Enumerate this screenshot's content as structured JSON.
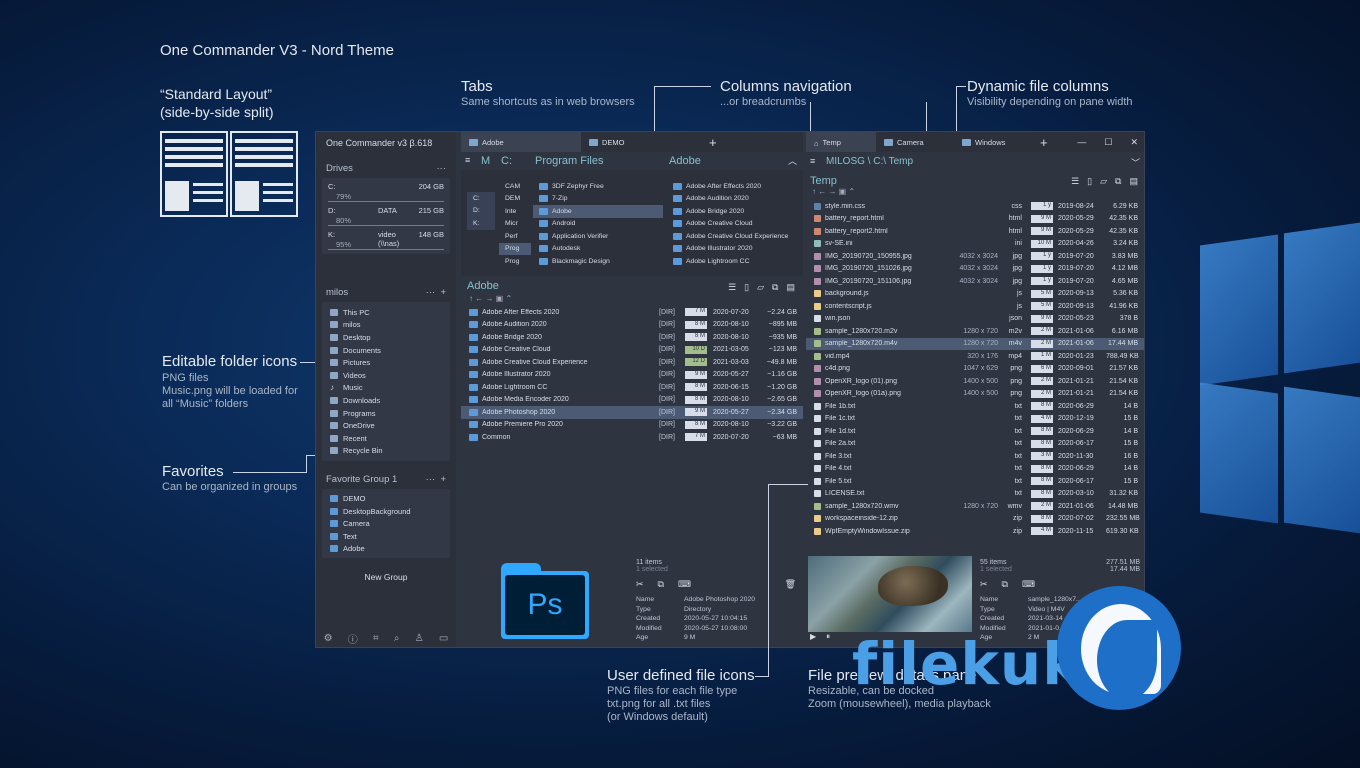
{
  "title": "One Commander V3 - Nord Theme",
  "annotations": {
    "layout": {
      "title": "“Standard Layout”",
      "subtitle": "(side-by-side split)"
    },
    "tabs": {
      "title": "Tabs",
      "subtitle": "Same shortcuts as in web browsers"
    },
    "columns_nav": {
      "title": "Columns navigation",
      "subtitle": "...or breadcrumbs"
    },
    "dynamic_cols": {
      "title": "Dynamic file columns",
      "subtitle": "Visibility depending on pane width"
    },
    "folder_icons": {
      "title": "Editable folder icons",
      "lines": [
        "PNG files",
        "Music.png will be loaded for",
        "all “Music” folders"
      ]
    },
    "favorites": {
      "title": "Favorites",
      "subtitle": "Can be organized in groups"
    },
    "file_icons": {
      "title": "User defined file icons",
      "lines": [
        "PNG files for each file type",
        "txt.png for all .txt files",
        "(or Windows default)"
      ]
    },
    "preview": {
      "title": "File preview, details pane",
      "lines": [
        "Resizable, can be docked",
        "Zoom (mousewheel), media playback"
      ]
    }
  },
  "app": {
    "title": "One Commander v3 β.618",
    "drives_header": "Drives",
    "drives": [
      {
        "name": "C:",
        "label": "",
        "percent": "79%",
        "size": "204 GB"
      },
      {
        "name": "D:",
        "label": "DATA",
        "percent": "80%",
        "size": "215 GB"
      },
      {
        "name": "K:",
        "label": "video (\\\\nas)",
        "percent": "95%",
        "size": "148 GB"
      }
    ],
    "user_header": "milos",
    "places": [
      "This PC",
      "milos",
      "Desktop",
      "Documents",
      "Pictures",
      "Videos",
      "Music",
      "Downloads",
      "Programs",
      "OneDrive",
      "Recent",
      "Recycle Bin"
    ],
    "fav_header": "Favorite Group 1",
    "favorites": [
      "DEMO",
      "DesktopBackground",
      "Camera",
      "Text",
      "Adobe"
    ],
    "new_group": "New Group",
    "dots": "···",
    "plus": "+",
    "left_tabs": [
      "Adobe",
      "DEMO"
    ],
    "right_tabs": [
      "Temp",
      "Camera",
      "Windows"
    ],
    "col_headers": [
      "M",
      "C:",
      "Program Files",
      "Adobe"
    ],
    "drive_col": [
      "C:",
      "D:",
      "K:"
    ],
    "c_col": [
      "CAM",
      "DEM",
      "Inte",
      "Micr",
      "Perf",
      "Prog",
      "Prog"
    ],
    "pf_col": [
      "3DF Zephyr Free",
      "7-Zip",
      "Adobe",
      "Android",
      "Application Verifier",
      "Autodesk",
      "Blackmagic Design"
    ],
    "adobe_col": [
      "Adobe After Effects 2020",
      "Adobe Audition 2020",
      "Adobe Bridge 2020",
      "Adobe Creative Cloud",
      "Adobe Creative Cloud Experience",
      "Adobe Illustrator 2020",
      "Adobe Lightroom CC"
    ],
    "left_pane_title": "Adobe",
    "left_files": [
      {
        "name": "Adobe After Effects 2020",
        "dir": "[DIR]",
        "bar": "7 M",
        "date": "2020-07-20",
        "size": "~2.24 GB"
      },
      {
        "name": "Adobe Audition 2020",
        "dir": "[DIR]",
        "bar": "8 M",
        "date": "2020-08-10",
        "size": "~895 MB"
      },
      {
        "name": "Adobe Bridge 2020",
        "dir": "[DIR]",
        "bar": "8 M",
        "date": "2020-08-10",
        "size": "~935 MB"
      },
      {
        "name": "Adobe Creative Cloud",
        "dir": "[DIR]",
        "bar": "10 D",
        "date": "2021-03-05",
        "size": "~123 MB"
      },
      {
        "name": "Adobe Creative Cloud Experience",
        "dir": "[DIR]",
        "bar": "12 D",
        "date": "2021-03-03",
        "size": "~49.8 MB"
      },
      {
        "name": "Adobe Illustrator 2020",
        "dir": "[DIR]",
        "bar": "9 M",
        "date": "2020-05-27",
        "size": "~1.16 GB"
      },
      {
        "name": "Adobe Lightroom CC",
        "dir": "[DIR]",
        "bar": "8 M",
        "date": "2020-06-15",
        "size": "~1.20 GB"
      },
      {
        "name": "Adobe Media Encoder 2020",
        "dir": "[DIR]",
        "bar": "8 M",
        "date": "2020-08-10",
        "size": "~2.65 GB"
      },
      {
        "name": "Adobe Photoshop 2020",
        "dir": "[DIR]",
        "bar": "9 M",
        "date": "2020-05-27",
        "size": "~2.34 GB"
      },
      {
        "name": "Adobe Premiere Pro 2020",
        "dir": "[DIR]",
        "bar": "8 M",
        "date": "2020-08-10",
        "size": "~3.22 GB"
      },
      {
        "name": "Common",
        "dir": "[DIR]",
        "bar": "7 M",
        "date": "2020-07-20",
        "size": "~63 MB"
      }
    ],
    "left_status": {
      "count": "11 items",
      "selected": "1 selected"
    },
    "left_props": [
      {
        "k": "Name",
        "v": "Adobe Photoshop 2020"
      },
      {
        "k": "Type",
        "v": "Directory"
      },
      {
        "k": "Created",
        "v": "2020-05-27 10:04:15"
      },
      {
        "k": "Modified",
        "v": "2020-05-27 10:08:00"
      },
      {
        "k": "Age",
        "v": "9 M"
      }
    ],
    "ps_label": "Ps",
    "right_breadcrumb": "MILOSG \\ C:\\ Temp",
    "right_pane_title": "Temp",
    "right_files": [
      {
        "name": "style.min.css",
        "dim": "",
        "ext": "css",
        "bar": "1 y",
        "date": "2019-08-24",
        "size": "6.29 KB"
      },
      {
        "name": "battery_report.html",
        "dim": "",
        "ext": "html",
        "bar": "9 M",
        "date": "2020-05-29",
        "size": "42.35 KB"
      },
      {
        "name": "battery_report2.html",
        "dim": "",
        "ext": "html",
        "bar": "9 M",
        "date": "2020-05-29",
        "size": "42.35 KB"
      },
      {
        "name": "sv-SE.ini",
        "dim": "",
        "ext": "ini",
        "bar": "10 M",
        "date": "2020-04-26",
        "size": "3.24 KB"
      },
      {
        "name": "IMG_20190720_150955.jpg",
        "dim": "4032 x 3024",
        "ext": "jpg",
        "bar": "1 y",
        "date": "2019-07-20",
        "size": "3.83 MB"
      },
      {
        "name": "IMG_20190720_151026.jpg",
        "dim": "4032 x 3024",
        "ext": "jpg",
        "bar": "1 y",
        "date": "2019-07-20",
        "size": "4.12 MB"
      },
      {
        "name": "IMG_20190720_151106.jpg",
        "dim": "4032 x 3024",
        "ext": "jpg",
        "bar": "1 y",
        "date": "2019-07-20",
        "size": "4.65 MB"
      },
      {
        "name": "background.js",
        "dim": "",
        "ext": "js",
        "bar": "5 M",
        "date": "2020-09-13",
        "size": "5.36 KB"
      },
      {
        "name": "contentscript.js",
        "dim": "",
        "ext": "js",
        "bar": "5 M",
        "date": "2020-09-13",
        "size": "41.96 KB"
      },
      {
        "name": "win.json",
        "dim": "",
        "ext": "json",
        "bar": "9 M",
        "date": "2020-05-23",
        "size": "378 B"
      },
      {
        "name": "sample_1280x720.m2v",
        "dim": "1280 x 720",
        "ext": "m2v",
        "bar": "2 M",
        "date": "2021-01-06",
        "size": "6.16 MB"
      },
      {
        "name": "sample_1280x720.m4v",
        "dim": "1280 x 720",
        "ext": "m4v",
        "bar": "2 M",
        "date": "2021-01-06",
        "size": "17.44 MB"
      },
      {
        "name": "vid.mp4",
        "dim": "320 x 176",
        "ext": "mp4",
        "bar": "1 M",
        "date": "2020-01-23",
        "size": "788.49 KB"
      },
      {
        "name": "c4d.png",
        "dim": "1047 x 629",
        "ext": "png",
        "bar": "6 M",
        "date": "2020-09-01",
        "size": "21.57 KB"
      },
      {
        "name": "OpenXR_logo (01).png",
        "dim": "1400 x 500",
        "ext": "png",
        "bar": "2 M",
        "date": "2021-01-21",
        "size": "21.54 KB"
      },
      {
        "name": "OpenXR_logo (01a).png",
        "dim": "1400 x 500",
        "ext": "png",
        "bar": "2 M",
        "date": "2021-01-21",
        "size": "21.54 KB"
      },
      {
        "name": "File 1b.txt",
        "dim": "",
        "ext": "txt",
        "bar": "8 M",
        "date": "2020-06-29",
        "size": "14 B"
      },
      {
        "name": "File 1c.txt",
        "dim": "",
        "ext": "txt",
        "bar": "4 M",
        "date": "2020-12-19",
        "size": "15 B"
      },
      {
        "name": "File 1d.txt",
        "dim": "",
        "ext": "txt",
        "bar": "8 M",
        "date": "2020-06-29",
        "size": "14 B"
      },
      {
        "name": "File 2a.txt",
        "dim": "",
        "ext": "txt",
        "bar": "8 M",
        "date": "2020-06-17",
        "size": "15 B"
      },
      {
        "name": "File 3.txt",
        "dim": "",
        "ext": "txt",
        "bar": "3 M",
        "date": "2020-11-30",
        "size": "16 B"
      },
      {
        "name": "File 4.txt",
        "dim": "",
        "ext": "txt",
        "bar": "8 M",
        "date": "2020-06-29",
        "size": "14 B"
      },
      {
        "name": "File 5.txt",
        "dim": "",
        "ext": "txt",
        "bar": "8 M",
        "date": "2020-06-17",
        "size": "15 B"
      },
      {
        "name": "LICENSE.txt",
        "dim": "",
        "ext": "txt",
        "bar": "8 M",
        "date": "2020-03-10",
        "size": "31.32 KB"
      },
      {
        "name": "sample_1280x720.wmv",
        "dim": "1280 x 720",
        "ext": "wmv",
        "bar": "2 M",
        "date": "2021-01-06",
        "size": "14.48 MB"
      },
      {
        "name": "workspaceinside-12.zip",
        "dim": "",
        "ext": "zip",
        "bar": "8 M",
        "date": "2020-07-02",
        "size": "232.55 MB"
      },
      {
        "name": "WpfEmptyWindowIssue.zip",
        "dim": "",
        "ext": "zip",
        "bar": "4 M",
        "date": "2020-11-15",
        "size": "619.30 KB"
      }
    ],
    "right_status": {
      "count": "55 items",
      "selected": "1 selected",
      "total": "277.51 MB",
      "sel_size": "17.44 MB"
    },
    "right_props": [
      {
        "k": "Name",
        "v": "sample_1280x7..."
      },
      {
        "k": "Type",
        "v": "Video | M4V"
      },
      {
        "k": "Created",
        "v": "2021-03-14"
      },
      {
        "k": "Modified",
        "v": "2021-01-0..."
      },
      {
        "k": "Age",
        "v": "2 M"
      }
    ]
  },
  "brand": {
    "text": "filekuka"
  },
  "colors": {
    "accent": "#88c0d0",
    "folder": "#5e9ad8",
    "selection": "#4c5a73",
    "background": "#2e3440"
  }
}
